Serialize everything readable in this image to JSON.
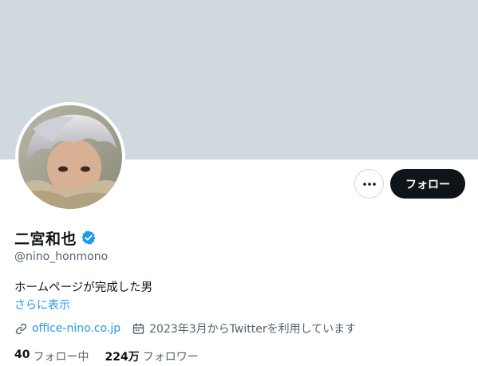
{
  "profile": {
    "display_name": "二宮和也",
    "handle": "@nino_honmono",
    "bio": "ホームページが完成した男",
    "show_more": "さらに表示",
    "website": "office-nino.co.jp",
    "joined": "2023年3月からTwitterを利用しています",
    "verified": true
  },
  "actions": {
    "more_label": "•••",
    "follow_label": "フォロー"
  },
  "stats": {
    "following_count": "40",
    "following_label": "フォロー中",
    "followers_count": "224万",
    "followers_label": "フォロワー"
  },
  "colors": {
    "banner": "#cfd9de",
    "accent": "#1d9bf0",
    "text": "#0f1419",
    "muted": "#536471",
    "follow_button_bg": "#0f1419"
  },
  "icons": {
    "verified": "verified-badge-icon",
    "website": "link-icon",
    "joined": "calendar-icon",
    "more": "more-dots-icon"
  }
}
